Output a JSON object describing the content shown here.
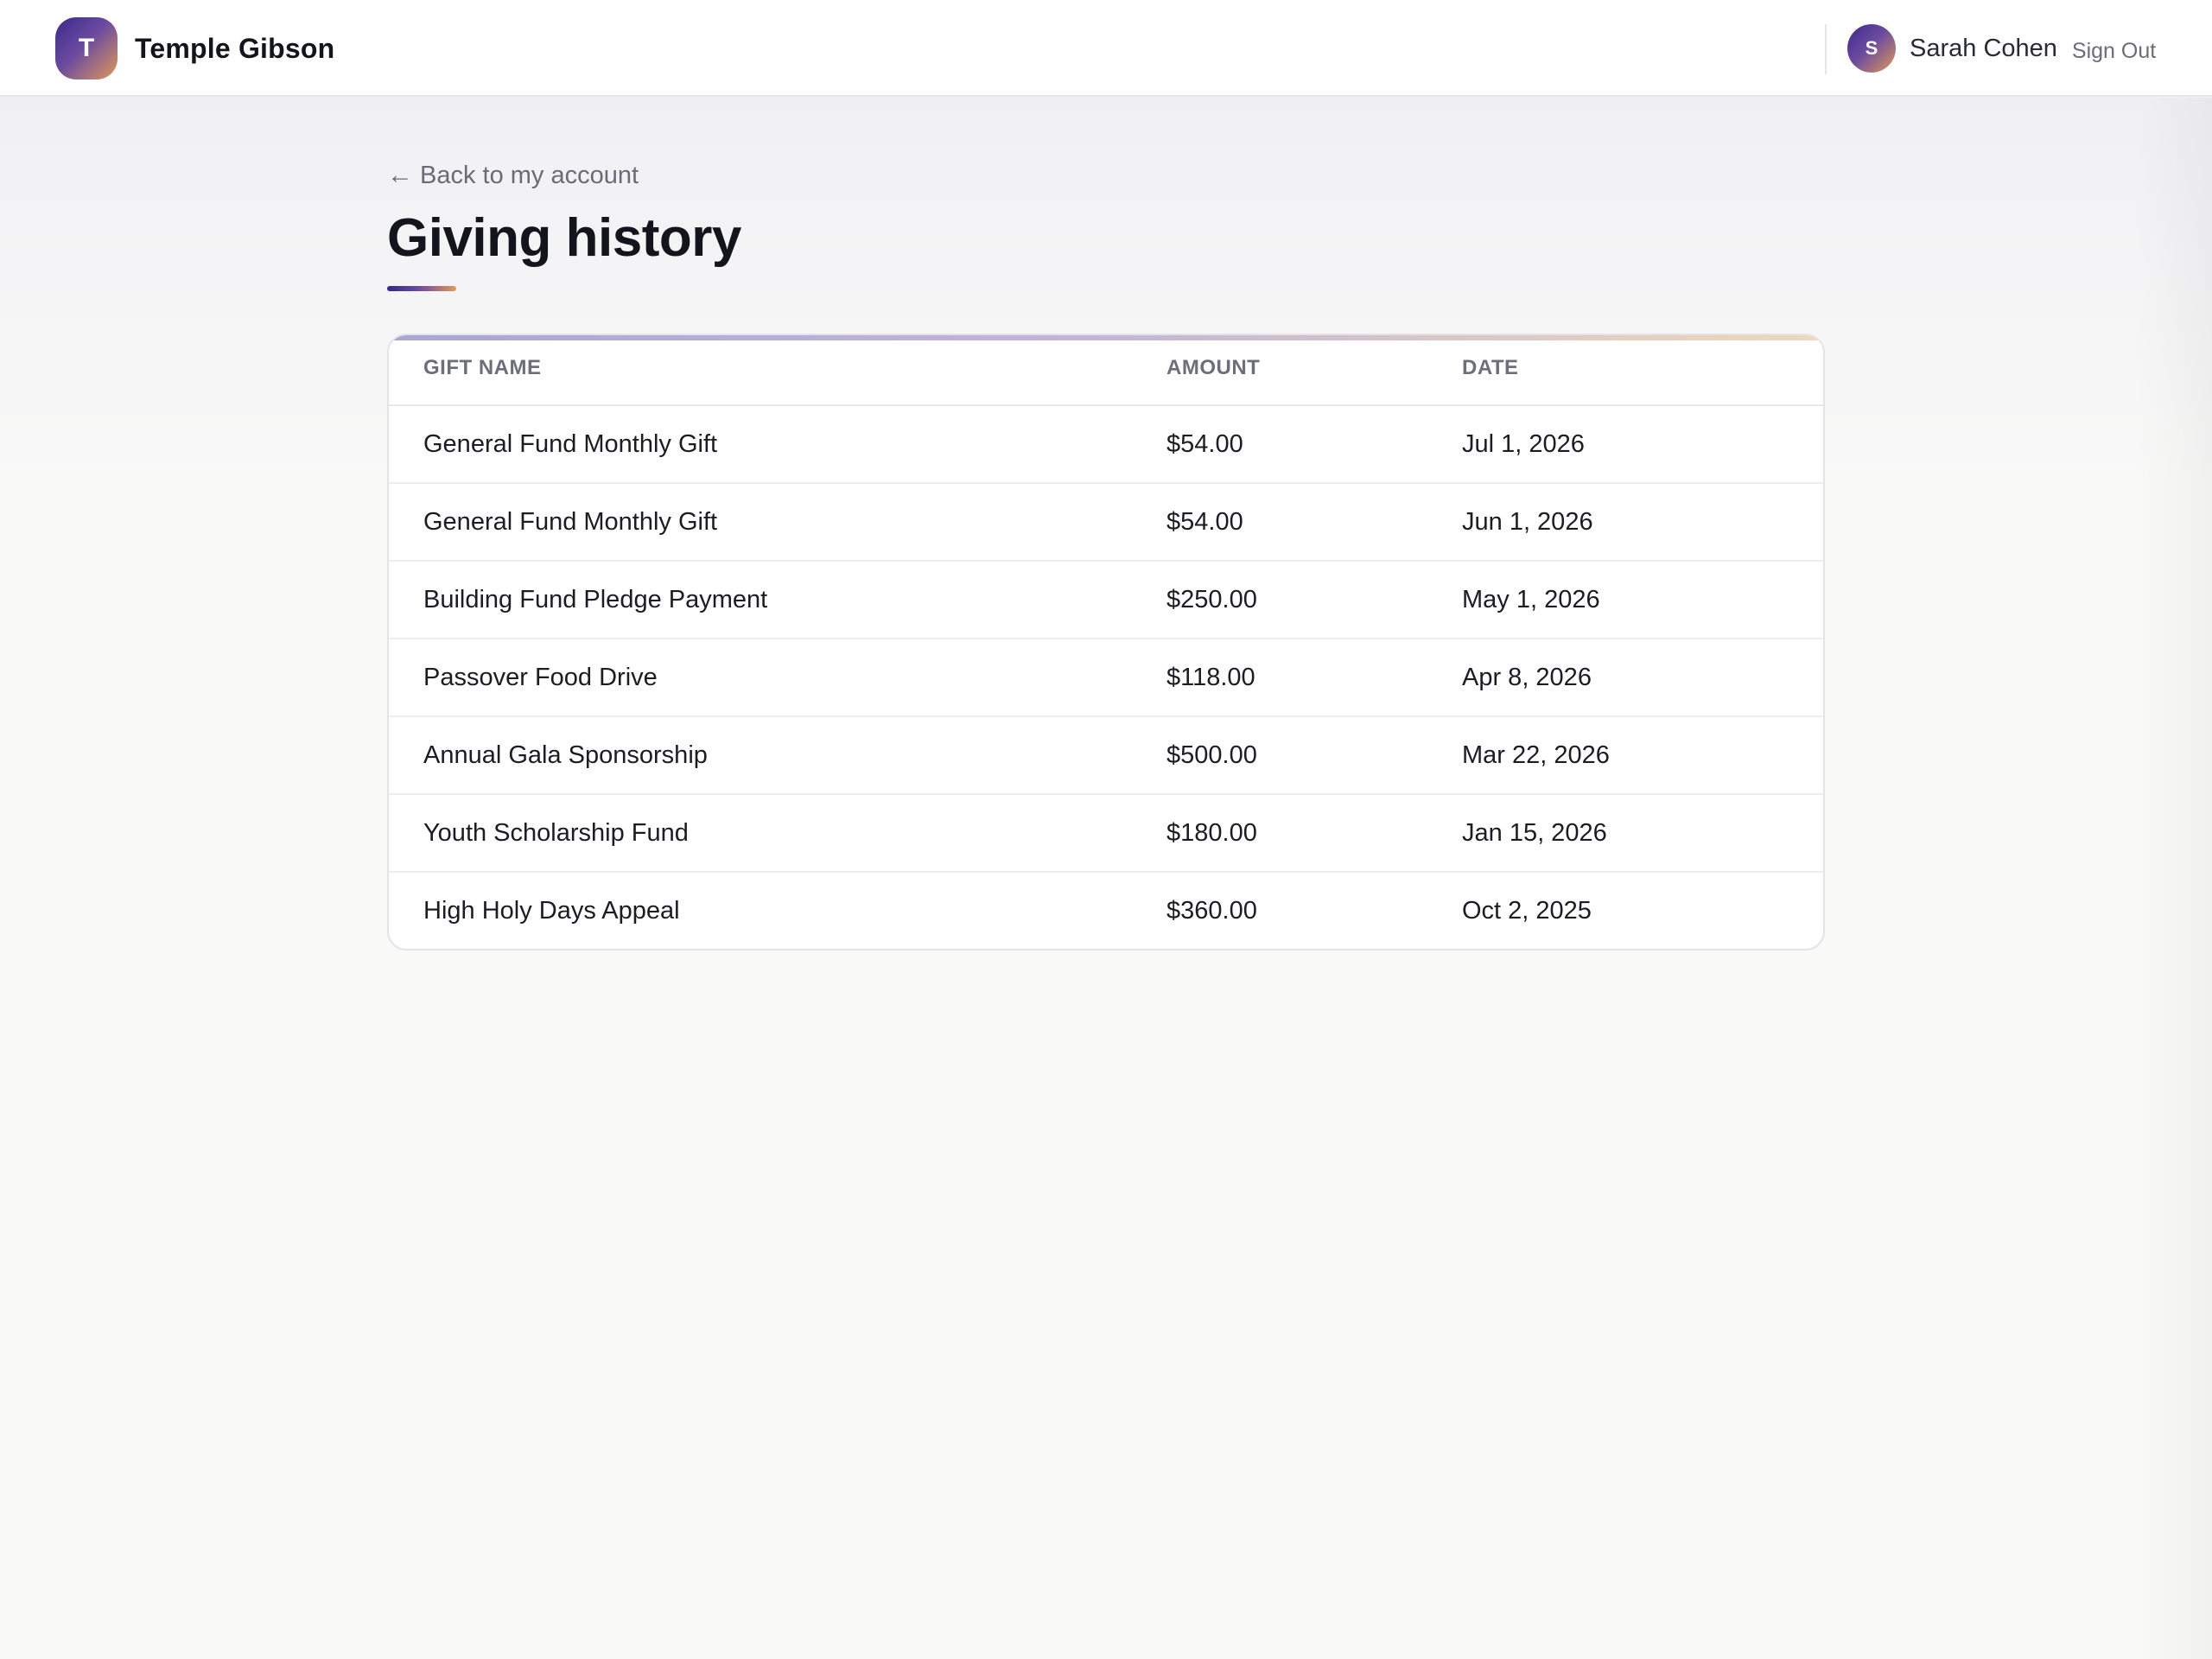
{
  "brand": {
    "initial": "T",
    "name": "Temple Gibson"
  },
  "user": {
    "initial": "S",
    "name": "Sarah Cohen",
    "sign_out_label": "Sign Out"
  },
  "nav": {
    "back_arrow": "←",
    "back_label": "Back to my account"
  },
  "page": {
    "title": "Giving history"
  },
  "table": {
    "headers": [
      "GIFT NAME",
      "AMOUNT",
      "DATE"
    ],
    "rows": [
      {
        "name": "General Fund Monthly Gift",
        "amount": "$54.00",
        "date": "Jul 1, 2026"
      },
      {
        "name": "General Fund Monthly Gift",
        "amount": "$54.00",
        "date": "Jun 1, 2026"
      },
      {
        "name": "Building Fund Pledge Payment",
        "amount": "$250.00",
        "date": "May 1, 2026"
      },
      {
        "name": "Passover Food Drive",
        "amount": "$118.00",
        "date": "Apr 8, 2026"
      },
      {
        "name": "Annual Gala Sponsorship",
        "amount": "$500.00",
        "date": "Mar 22, 2026"
      },
      {
        "name": "Youth Scholarship Fund",
        "amount": "$180.00",
        "date": "Jan 15, 2026"
      },
      {
        "name": "High Holy Days Appeal",
        "amount": "$360.00",
        "date": "Oct 2, 2025"
      }
    ]
  },
  "colors": {
    "brand_dark": "#3c2a8a",
    "brand_purple": "#6a4aa0",
    "brand_warm": "#e09a58"
  },
  "icons": {
    "back": "arrow-left-icon"
  }
}
